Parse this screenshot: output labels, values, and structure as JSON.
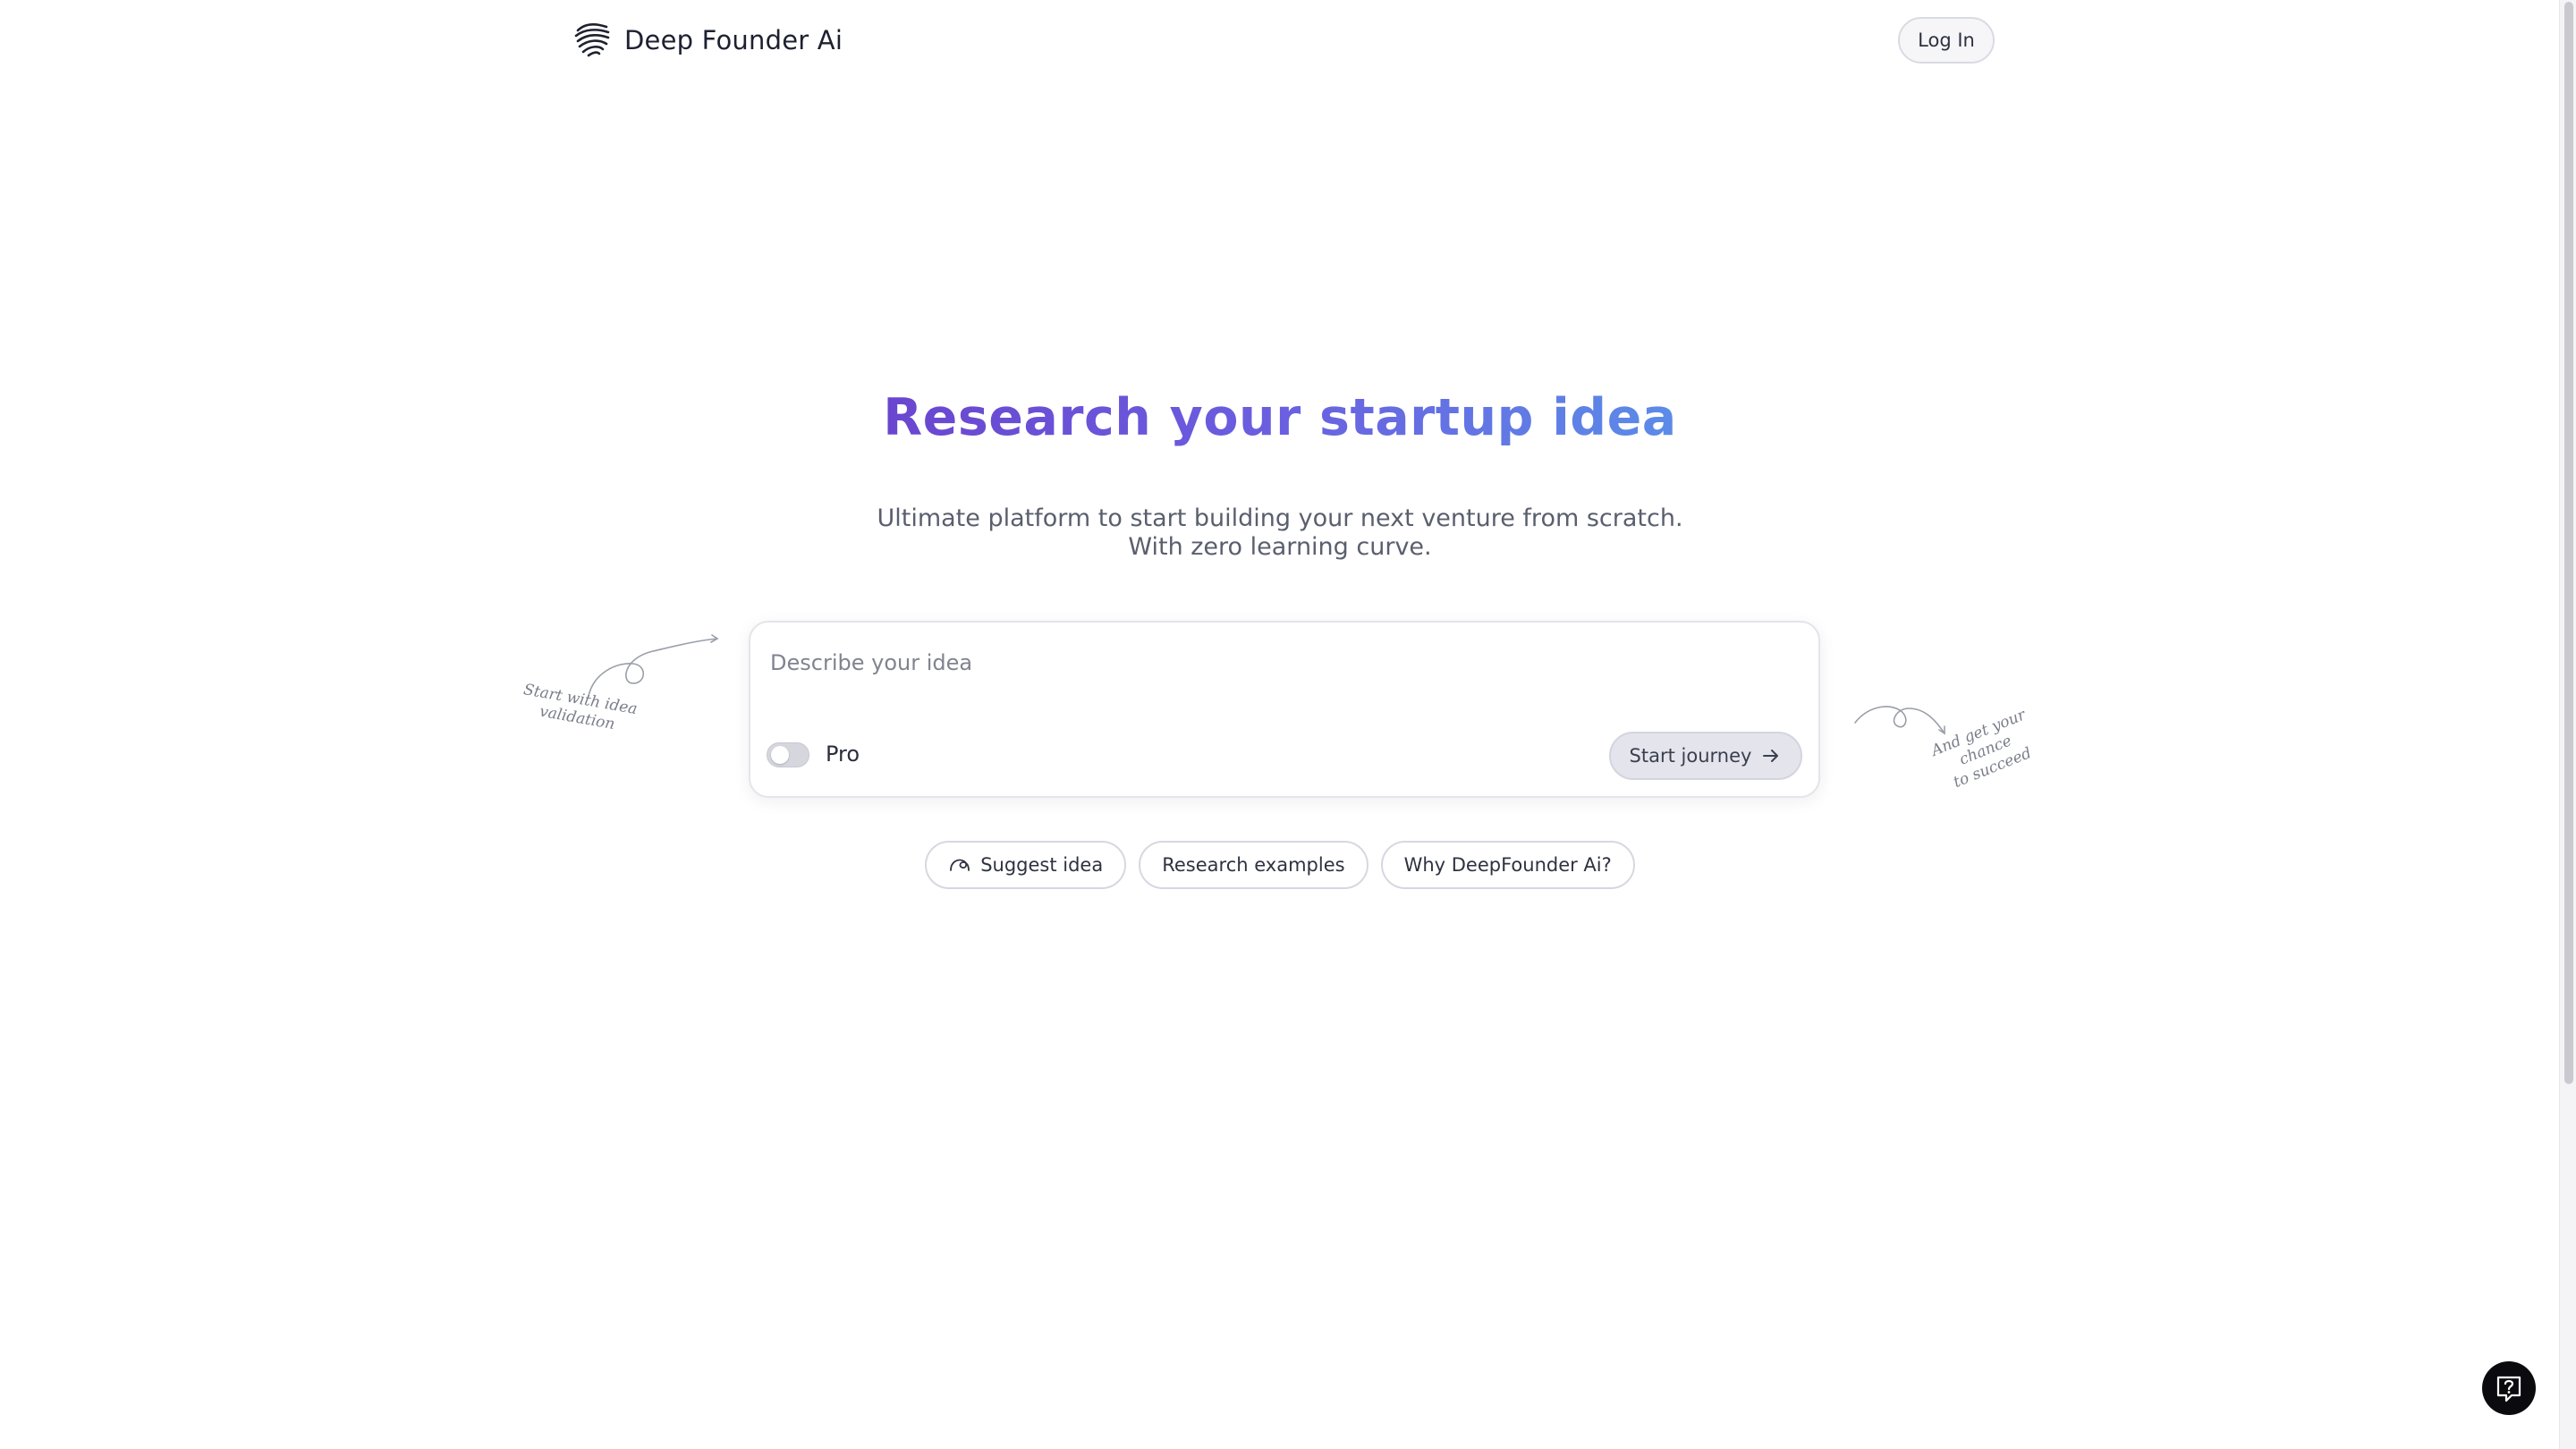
{
  "header": {
    "brand_name": "Deep Founder Ai",
    "login_label": "Log In",
    "brand_icon": "layered-waves-logo-icon"
  },
  "hero": {
    "title": "Research your startup idea",
    "subtitle": "Ultimate platform to start building your next venture from scratch. With zero learning curve.",
    "title_gradient": [
      "#6a46cf",
      "#5b8ce8"
    ]
  },
  "idea_form": {
    "placeholder": "Describe your idea",
    "value": "",
    "pro_label": "Pro",
    "pro_enabled": false,
    "submit_label": "Start journey",
    "submit_icon": "arrow-right-icon"
  },
  "annotations": {
    "left": "Start with idea\nvalidation",
    "right": "And get your chance\nto succeed"
  },
  "chips": [
    {
      "label": "Suggest idea",
      "icon": "sparkle-loop-icon"
    },
    {
      "label": "Research examples"
    },
    {
      "label": "Why DeepFounder Ai?"
    }
  ],
  "help": {
    "icon": "help-question-icon"
  },
  "colors": {
    "text": "#1f2430",
    "muted": "#5a5f6e",
    "border": "#d6d8e0",
    "button_bg": "#e3e4ec",
    "help_bg": "#0b0b0f"
  }
}
